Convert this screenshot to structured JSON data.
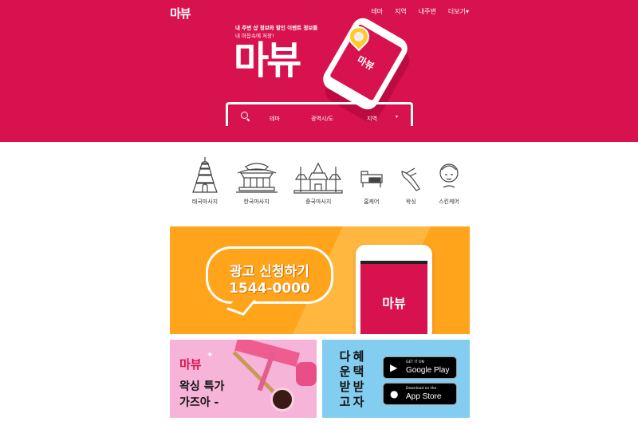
{
  "header": {
    "logo": "마뷰",
    "nav": [
      "테마",
      "지역",
      "내주변",
      "더보기▾"
    ]
  },
  "hero": {
    "tagline_1": "내 주변 샵 정보와 할인 이벤트 정보를",
    "tagline_2": "내 마음속에 저장!",
    "logo_big": "마뷰",
    "phone_logo": "마뷰"
  },
  "search": {
    "fields": [
      "테마",
      "광역시/도",
      "지역"
    ],
    "caret": "▾"
  },
  "categories": [
    {
      "label": "태국마사지",
      "icon": "thai-temple-icon"
    },
    {
      "label": "한국마사지",
      "icon": "korean-palace-icon"
    },
    {
      "label": "중국마사지",
      "icon": "chinese-temple-icon"
    },
    {
      "label": "홈케어",
      "icon": "sofa-icon"
    },
    {
      "label": "왁싱",
      "icon": "leg-wax-icon"
    },
    {
      "label": "스킨케어",
      "icon": "face-mask-icon"
    }
  ],
  "ad_banner": {
    "title": "광고 신청하기",
    "phone": "1544-0000",
    "app_logo": "마뷰"
  },
  "wax_banner": {
    "brand": "마뷰",
    "line1": "왁싱 특가",
    "line2": "가즈아 -"
  },
  "app_banner": {
    "col1": [
      "다",
      "운",
      "받",
      "고"
    ],
    "col2": [
      "혜",
      "택",
      "받",
      "자"
    ],
    "google": {
      "small": "GET IT ON",
      "big": "Google Play"
    },
    "apple": {
      "small": "Download on the",
      "big": "App Store"
    }
  },
  "colors": {
    "brand": "#d8124f",
    "ad_orange": "#ffa41b",
    "wax_pink": "#f6b4d9",
    "app_blue": "#83cdf0"
  }
}
